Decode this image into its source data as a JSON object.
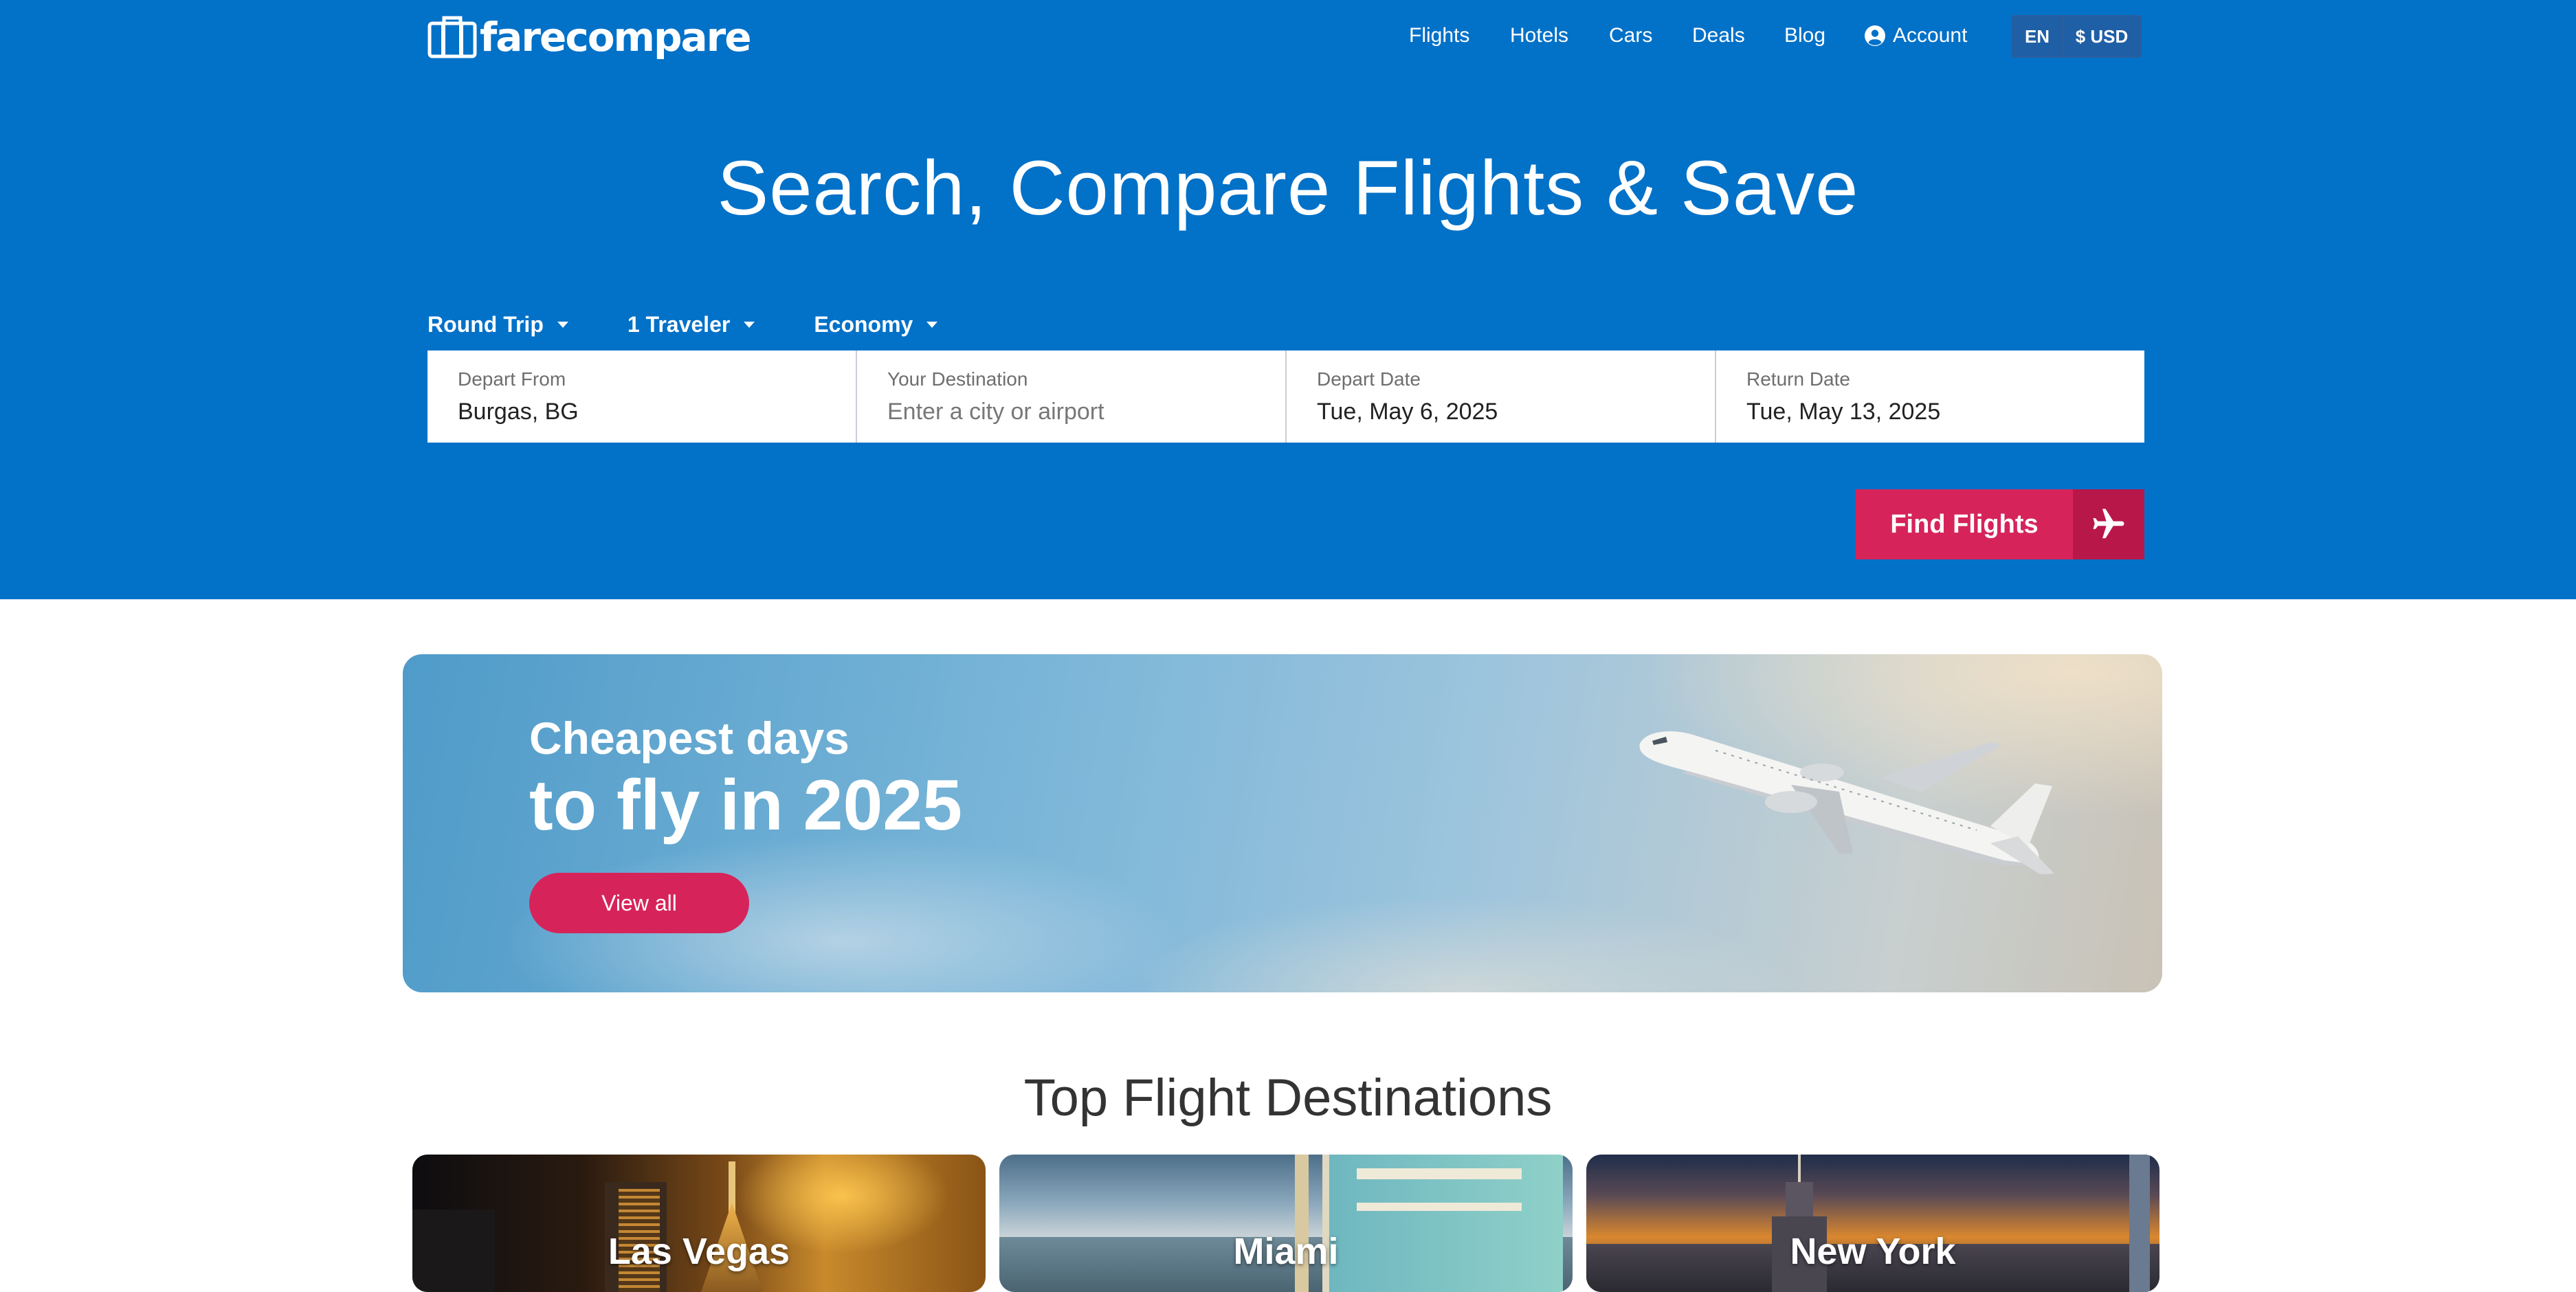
{
  "brand": {
    "name": "farecompare"
  },
  "nav": {
    "items": [
      "Flights",
      "Hotels",
      "Cars",
      "Deals",
      "Blog"
    ],
    "account": "Account",
    "language": "EN",
    "currency": "$ USD"
  },
  "hero": {
    "title": "Search, Compare Flights & Save"
  },
  "search": {
    "trip_type": "Round Trip",
    "travelers": "1 Traveler",
    "cabin": "Economy",
    "depart_from": {
      "label": "Depart From",
      "value": "Burgas, BG"
    },
    "destination": {
      "label": "Your Destination",
      "placeholder": "Enter a city or airport",
      "value": ""
    },
    "depart_date": {
      "label": "Depart Date",
      "value": "Tue, May 6, 2025"
    },
    "return_date": {
      "label": "Return Date",
      "value": "Tue, May 13, 2025"
    },
    "submit_label": "Find Flights"
  },
  "banner": {
    "line1": "Cheapest days",
    "line2": "to fly in 2025",
    "button_label": "View all"
  },
  "destinations": {
    "title": "Top Flight Destinations",
    "cards": [
      "Las Vegas",
      "Miami",
      "New York"
    ]
  },
  "colors": {
    "primary_blue": "#0271c8",
    "accent_pink": "#d6245b",
    "accent_pink_dark": "#b8174a"
  }
}
